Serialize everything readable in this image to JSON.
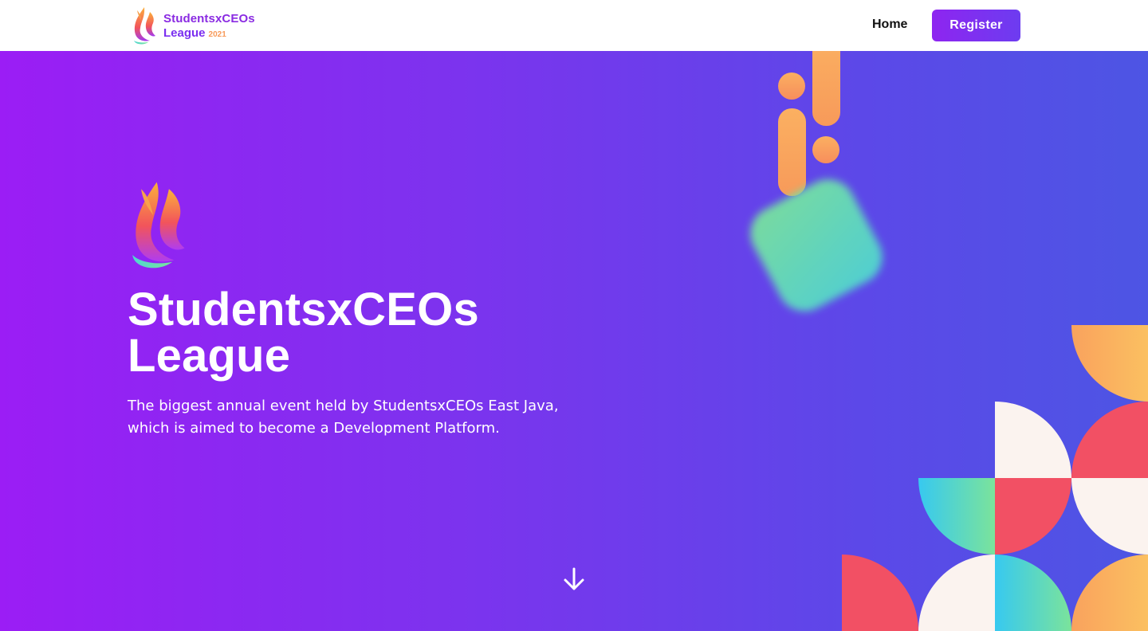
{
  "navbar": {
    "brand_line1": "StudentsxCEOs",
    "brand_league": "League",
    "brand_year": "2021",
    "home_label": "Home",
    "register_label": "Register"
  },
  "hero": {
    "title_line1": "StudentsxCEOs",
    "title_line2": "League",
    "subtitle_line1": "The biggest annual event held by StudentsxCEOs East Java,",
    "subtitle_line2": "which is aimed to become a Development Platform.",
    "scroll_icon": "arrow-down-icon"
  },
  "colors": {
    "hero_gradient_start": "#9b1df5",
    "hero_gradient_end": "#4d55e4",
    "register_button": "#8e25f0",
    "accent_orange": "#f9a25d",
    "accent_coral": "#f25064",
    "accent_cream": "#fbf3ef",
    "accent_teal": "#4fd6d2"
  }
}
